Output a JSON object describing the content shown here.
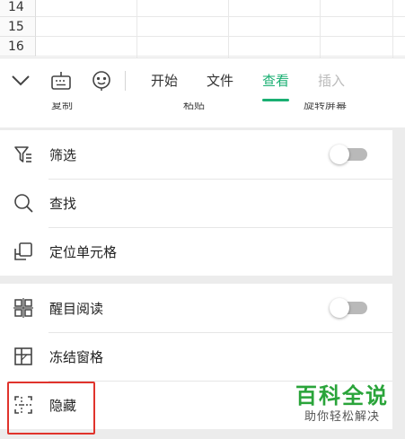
{
  "sheet": {
    "row_numbers": [
      "14",
      "15",
      "16"
    ]
  },
  "toolbar": {
    "icons": [
      "chevron-down-icon",
      "keyboard-icon",
      "emoji-icon"
    ],
    "tabs": [
      {
        "label": "开始",
        "state": "normal"
      },
      {
        "label": "文件",
        "state": "normal"
      },
      {
        "label": "查看",
        "state": "active"
      },
      {
        "label": "插入",
        "state": "faded"
      }
    ]
  },
  "peek_row": {
    "labels": [
      "复制",
      "粘贴",
      "旋转屏幕"
    ]
  },
  "menu": {
    "group1": [
      {
        "label": "筛选",
        "icon": "filter-icon",
        "toggle": false
      },
      {
        "label": "查找",
        "icon": "search-icon"
      },
      {
        "label": "定位单元格",
        "icon": "locate-cell-icon"
      }
    ],
    "group2": [
      {
        "label": "醒目阅读",
        "icon": "highlight-reading-icon",
        "toggle": false
      },
      {
        "label": "冻结窗格",
        "icon": "freeze-panes-icon"
      },
      {
        "label": "隐藏",
        "icon": "hide-icon",
        "highlighted": true
      }
    ]
  },
  "watermark": {
    "title": "百科全说",
    "subtitle": "助你轻松解决"
  },
  "colors": {
    "accent": "#1aaf72",
    "highlight_border": "#e0332c",
    "watermark_green": "#2aa43a"
  }
}
